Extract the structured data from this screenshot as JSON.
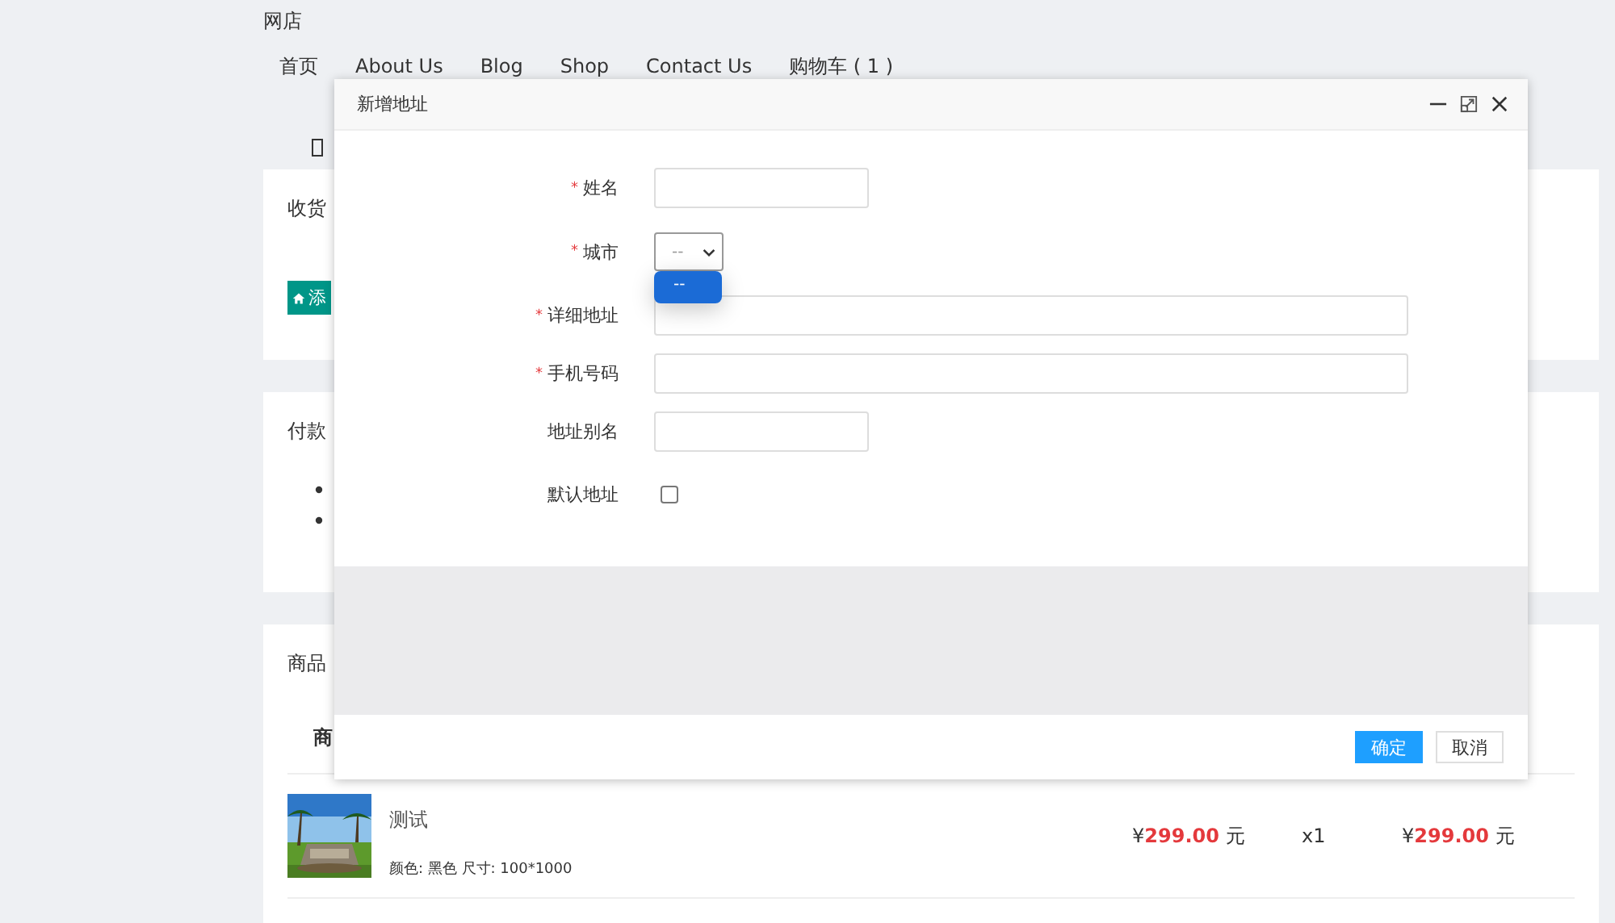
{
  "site": {
    "title": "网店",
    "nav": [
      {
        "label": "首页"
      },
      {
        "label": "About Us"
      },
      {
        "label": "Blog"
      },
      {
        "label": "Shop"
      },
      {
        "label": "Contact Us"
      },
      {
        "label": "购物车 ( 1 )"
      }
    ]
  },
  "address_card": {
    "title": "收货",
    "button": "添"
  },
  "payment_card": {
    "title": "付款"
  },
  "product_card": {
    "title": "商品",
    "column_1": "商",
    "rows": [
      {
        "name": "测试",
        "spec": "颜色: 黑色 尺寸: 100*1000",
        "price": {
          "currency": "¥",
          "amount": "299.00",
          "unit": "元"
        },
        "quantity": "x1",
        "total": {
          "currency": "¥",
          "amount": "299.00",
          "unit": "元"
        }
      }
    ]
  },
  "dialog": {
    "title": "新增地址",
    "fields": [
      {
        "kind": "short-text",
        "label": "姓名",
        "required_mark": "*"
      },
      {
        "kind": "select",
        "label": "城市",
        "required_mark": "*",
        "value": "--",
        "expanded": true,
        "options": [
          {
            "label": "--",
            "selected": true
          }
        ]
      },
      {
        "kind": "long-text",
        "label": "详细地址",
        "required_mark": "*"
      },
      {
        "kind": "long-text",
        "label": "手机号码",
        "required_mark": "*"
      },
      {
        "kind": "short-text",
        "label": "地址别名"
      },
      {
        "kind": "checkbox",
        "label": "默认地址",
        "checked": false
      }
    ],
    "buttons": [
      {
        "label": "确定",
        "kind": "primary"
      },
      {
        "label": "取消",
        "kind": "default"
      }
    ]
  }
}
